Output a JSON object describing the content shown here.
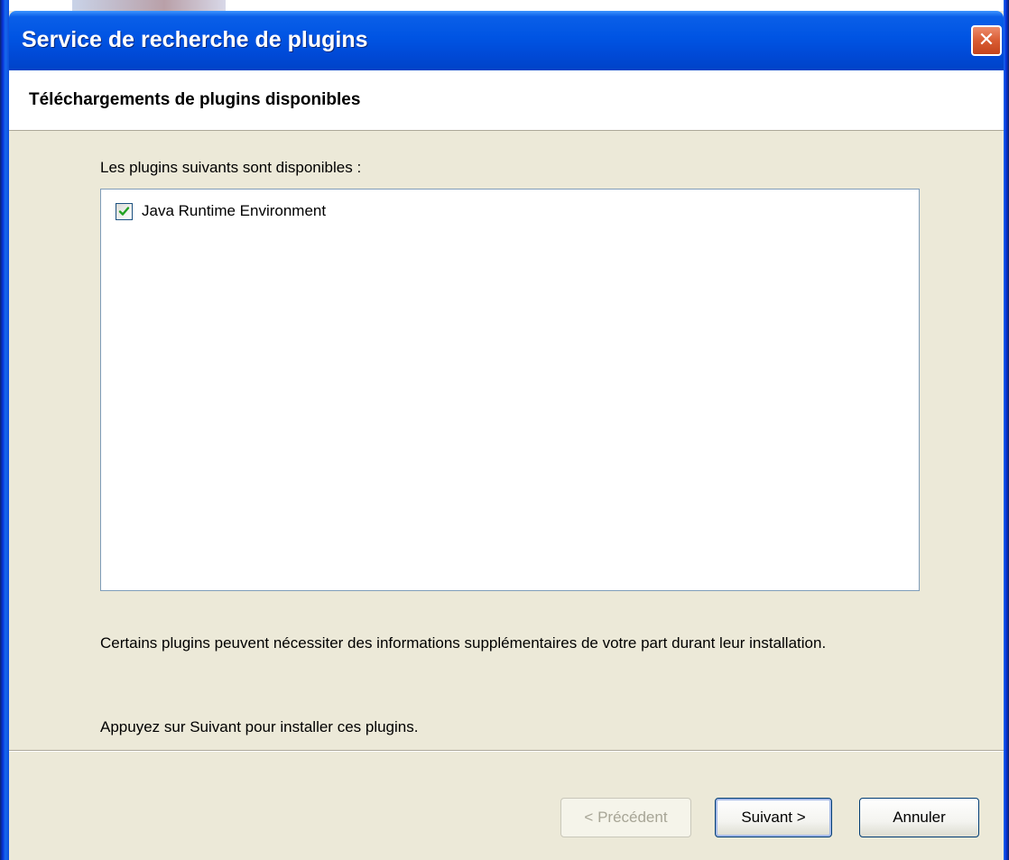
{
  "window": {
    "title": "Service de recherche de plugins",
    "close_glyph": "✕"
  },
  "header": {
    "title": "Téléchargements de plugins disponibles"
  },
  "main": {
    "available_label": "Les plugins suivants sont disponibles :",
    "plugins": [
      {
        "label": "Java Runtime Environment",
        "checked": true
      }
    ],
    "info_text": "Certains plugins peuvent nécessiter des informations supplémentaires de votre part durant leur installation.",
    "instruction_text": "Appuyez sur Suivant pour installer ces plugins."
  },
  "buttons": {
    "previous": "< Précédent",
    "next": "Suivant >",
    "cancel": "Annuler"
  },
  "colors": {
    "titlebar": "#0054e3",
    "dialog_bg": "#ece9d8",
    "check_mark": "#21a121"
  },
  "icons": {
    "close": "close-icon",
    "check": "checkmark-icon"
  }
}
